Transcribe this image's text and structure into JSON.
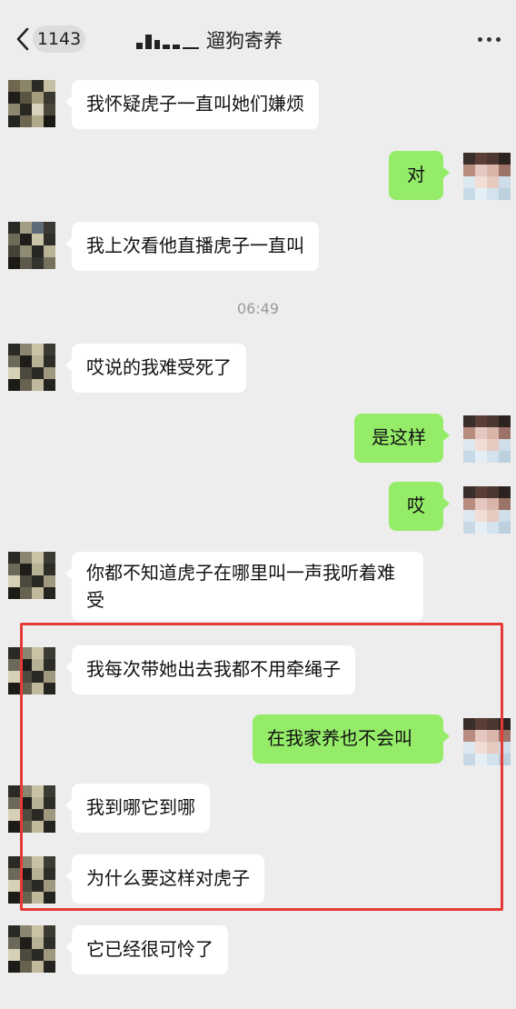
{
  "header": {
    "unread_count": "1143",
    "title": "遛狗寄养"
  },
  "timestamp": "06:49",
  "messages": [
    {
      "side": "left",
      "text": "我怀疑虎子一直叫她们嫌烦"
    },
    {
      "side": "right",
      "text": "对"
    },
    {
      "side": "left",
      "text": "我上次看他直播虎子一直叫"
    },
    {
      "side": "left",
      "text": "哎说的我难受死了"
    },
    {
      "side": "right",
      "text": "是这样"
    },
    {
      "side": "right",
      "text": "哎"
    },
    {
      "side": "left",
      "text": "你都不知道虎子在哪里叫一声我听着难受"
    },
    {
      "side": "left",
      "text": "我每次带她出去我都不用牵绳子"
    },
    {
      "side": "right",
      "text": "在我家养也不会叫"
    },
    {
      "side": "left",
      "text": "我到哪它到哪"
    },
    {
      "side": "left",
      "text": "为什么要这样对虎子"
    },
    {
      "side": "left",
      "text": "它已经很可怜了"
    }
  ],
  "colors": {
    "background": "#ededed",
    "bubble_left": "#ffffff",
    "bubble_right": "#95ec69",
    "highlight_border": "#e53935"
  },
  "icons": [
    "back-chevron-icon",
    "more-options-icon"
  ]
}
